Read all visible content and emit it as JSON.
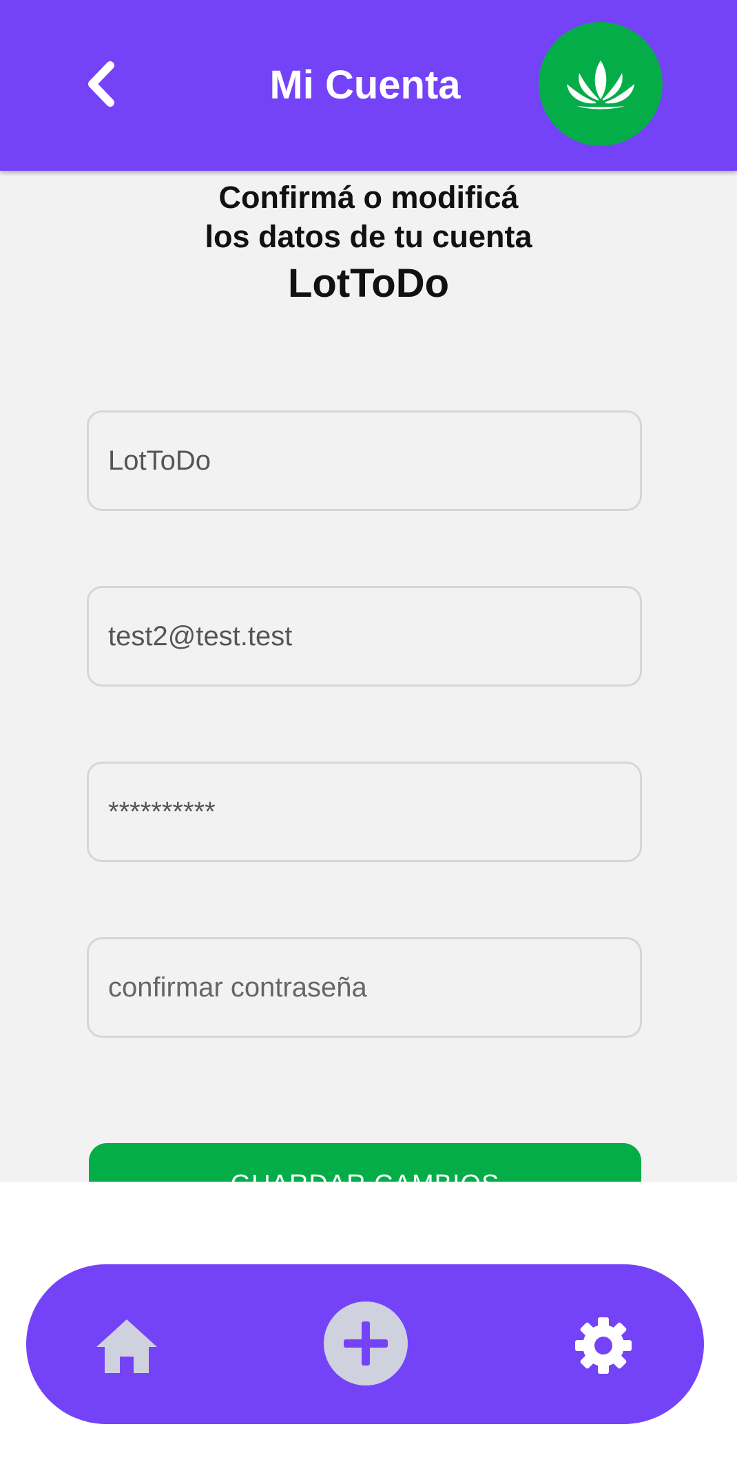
{
  "app_bar": {
    "title": "Mi Cuenta",
    "back_icon": "chevron-left-icon",
    "logo_icon": "lotus-icon",
    "color": "#7443f8",
    "logo_color": "#05ad49"
  },
  "heading": {
    "line1": "Confirmá o modificá",
    "line2": "los datos de tu cuenta",
    "app_name": "LotToDo"
  },
  "form": {
    "username": {
      "value": "LotToDo",
      "placeholder": ""
    },
    "email": {
      "value": "test2@test.test",
      "placeholder": ""
    },
    "password": {
      "value": "**********",
      "placeholder": ""
    },
    "confirm_password": {
      "value": "",
      "placeholder": "confirmar contraseña"
    },
    "save_label": "GUARDAR CAMBIOS"
  },
  "bottom_nav": {
    "items": [
      {
        "icon": "home-icon"
      },
      {
        "icon": "add-circle-icon"
      },
      {
        "icon": "gear-icon"
      }
    ],
    "color": "#7443f8"
  }
}
